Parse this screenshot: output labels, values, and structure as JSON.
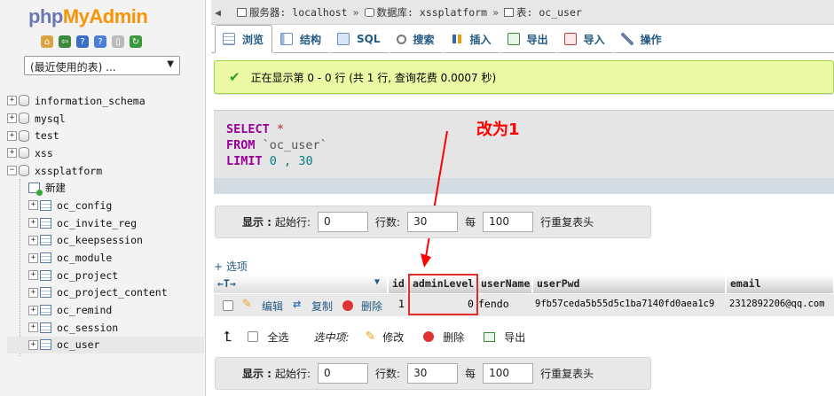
{
  "logo": {
    "part1": "php",
    "part2": "MyAdmin"
  },
  "recent_select": {
    "value": "(最近使用的表) ..."
  },
  "tree": {
    "databases": [
      "information_schema",
      "mysql",
      "test",
      "xss",
      "xssplatform"
    ],
    "new_label": "新建",
    "tables": [
      "oc_config",
      "oc_invite_reg",
      "oc_keepsession",
      "oc_module",
      "oc_project",
      "oc_project_content",
      "oc_remind",
      "oc_session",
      "oc_user"
    ]
  },
  "breadcrumb": {
    "server": "服务器: localhost",
    "database": "数据库: xssplatform",
    "table": "表: oc_user"
  },
  "tabs": [
    {
      "label": "浏览",
      "icon": "browse-icon",
      "active": true
    },
    {
      "label": "结构",
      "icon": "structure-icon"
    },
    {
      "label": "SQL",
      "icon": "sql-icon"
    },
    {
      "label": "搜索",
      "icon": "search-icon"
    },
    {
      "label": "插入",
      "icon": "insert-icon"
    },
    {
      "label": "导出",
      "icon": "export-icon"
    },
    {
      "label": "导入",
      "icon": "import-icon"
    },
    {
      "label": "操作",
      "icon": "wrench-icon"
    }
  ],
  "success_message": "正在显示第 0 - 0 行 (共 1 行, 查询花费 0.0007 秒)",
  "sql": {
    "select": "SELECT",
    "star": "*",
    "from": "FROM",
    "table": "`oc_user`",
    "limit": "LIMIT",
    "limit_args_a": "0",
    "limit_comma": " , ",
    "limit_args_b": "30"
  },
  "nav": {
    "show_label": "显示 :",
    "start_label": "起始行:",
    "start_value": "0",
    "rows_label": "行数:",
    "rows_value": "30",
    "every_label": "每",
    "every_value": "100",
    "repeat_label": "行重复表头"
  },
  "annotation": "改为1",
  "options_link": "+ 选项",
  "columns": [
    "id",
    "adminLevel",
    "userName",
    "userPwd",
    "email"
  ],
  "row": {
    "edit": "编辑",
    "copy": "复制",
    "delete": "删除",
    "id": "1",
    "adminLevel": "0",
    "userName": "fendo",
    "userPwd": "9fb57ceda5b55d5c1ba7140fd0aea1c9",
    "email": "2312892206@qq.com"
  },
  "bulk": {
    "select_all": "全选",
    "selected_label": "选中项:",
    "edit": "修改",
    "delete": "删除",
    "export": "导出"
  },
  "colors": {
    "accent": "#235a81",
    "success_bg": "#ebf8a4",
    "keyword": "#990099",
    "annotation": "#ff0000"
  }
}
